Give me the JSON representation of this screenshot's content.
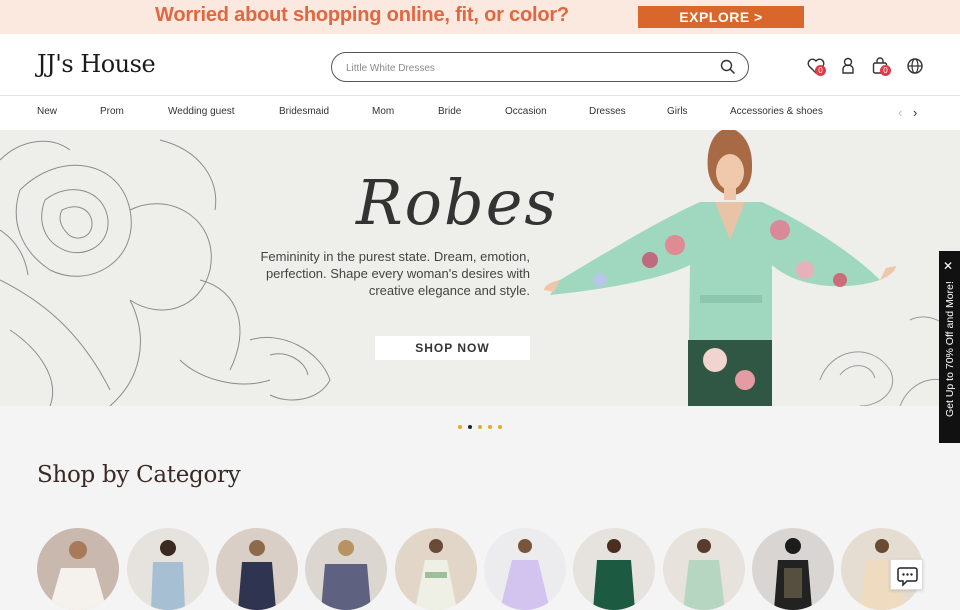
{
  "promo": {
    "text": "Worried about shopping online, fit, or color?",
    "button": "EXPLORE >"
  },
  "header": {
    "logo": "JJ's House",
    "search_placeholder": "Little White Dresses",
    "wishlist_count": "0",
    "cart_count": "0"
  },
  "nav": {
    "items": [
      "New",
      "Prom",
      "Wedding guest",
      "Bridesmaid",
      "Mom",
      "Bride",
      "Occasion",
      "Dresses",
      "Girls",
      "Accessories & shoes"
    ]
  },
  "hero": {
    "title": "Robes",
    "subtitle_lines": [
      "Femininity in the purest state. Dream, emotion,",
      "perfection. Shape every woman's desires with",
      "creative elegance and style."
    ],
    "button": "SHOP NOW",
    "slide_count": 5,
    "active_slide": 2
  },
  "side_tab": {
    "text": "Get Up to 70% Off and More!"
  },
  "categories": {
    "title": "Shop by Category",
    "items": [
      {
        "color": "#c9b8ad"
      },
      {
        "color": "#b7c7d4"
      },
      {
        "color": "#3d4158"
      },
      {
        "color": "#6c6f86"
      },
      {
        "color": "#d8c7b2"
      },
      {
        "color": "#ddd3ec"
      },
      {
        "color": "#1f5c46"
      },
      {
        "color": "#b9d2c0"
      },
      {
        "color": "#2b2727"
      },
      {
        "color": "#e9d9c4"
      }
    ]
  },
  "colors": {
    "accent": "#d9662b",
    "promo_bg": "#fbe9df",
    "badge": "#e03a4a",
    "dot": "#e8a91f"
  }
}
